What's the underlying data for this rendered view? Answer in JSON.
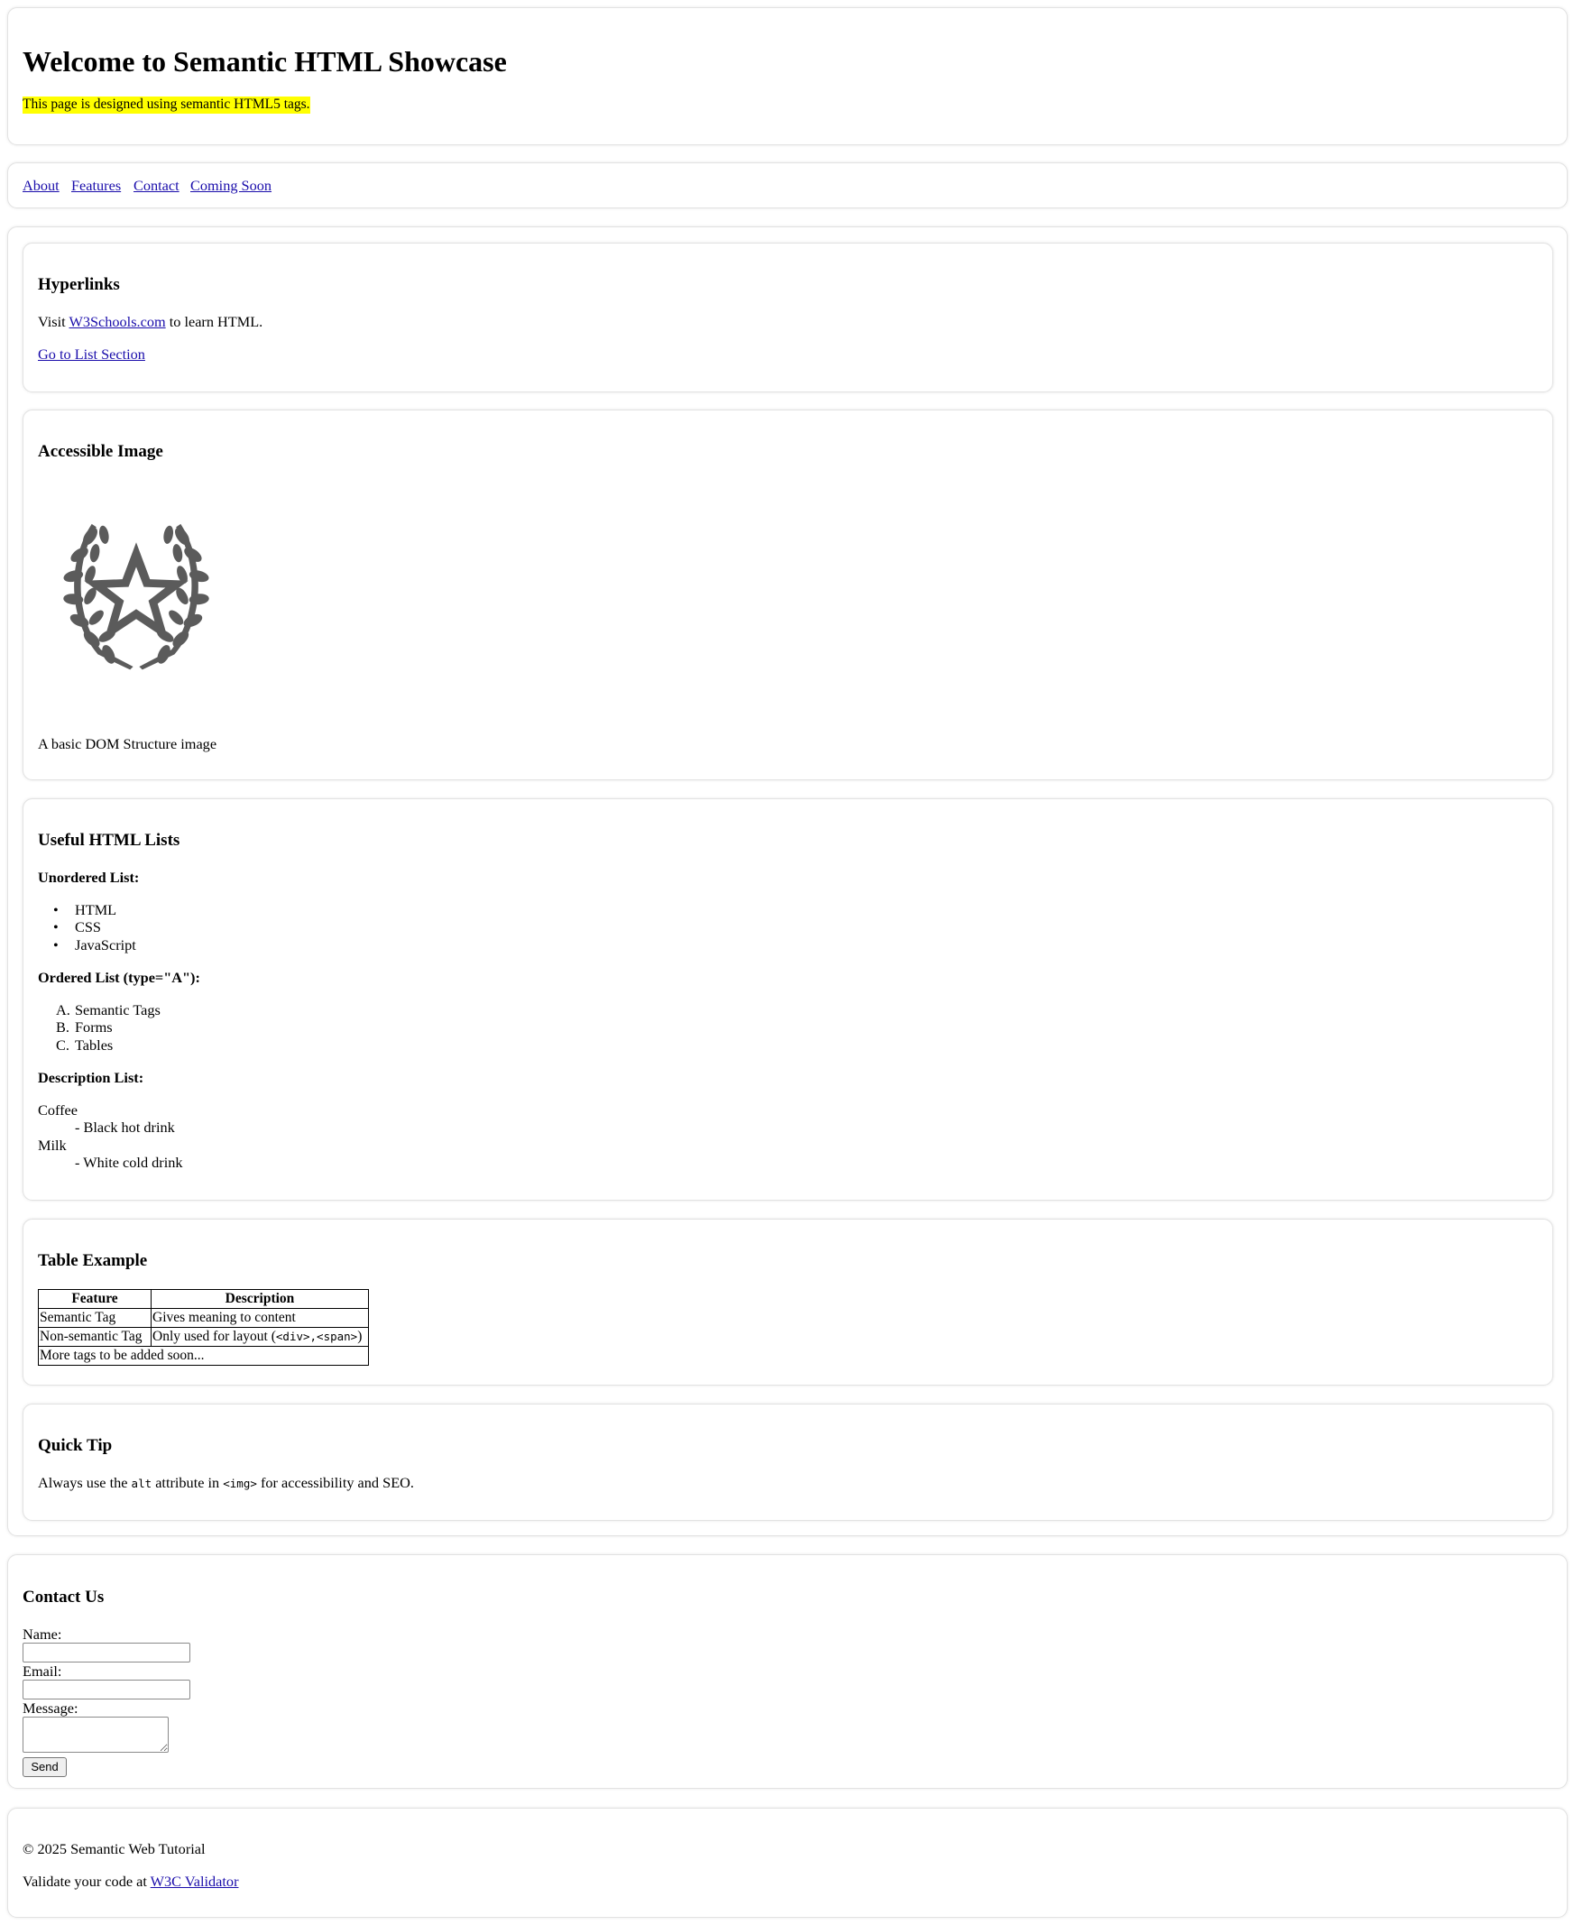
{
  "header": {
    "title": "Welcome to Semantic HTML Showcase",
    "highlight": "This page is designed using semantic HTML5 tags."
  },
  "nav": {
    "links": [
      "About",
      "Features",
      "Contact",
      "Coming Soon"
    ]
  },
  "hyperlinks": {
    "heading": "Hyperlinks",
    "visit_prefix": "Visit ",
    "visit_link": "W3Schools.com",
    "visit_suffix": " to learn HTML.",
    "anchor_link": "Go to List Section"
  },
  "image_section": {
    "heading": "Accessible Image",
    "caption": "A basic DOM Structure image",
    "image_icon": "laurel-star-emblem-icon",
    "image_color": "#5b5b5b"
  },
  "lists": {
    "heading": "Useful HTML Lists",
    "unordered_label": "Unordered List:",
    "unordered_items": [
      "HTML",
      "CSS",
      "JavaScript"
    ],
    "ordered_label": "Ordered List (type=\"A\"):",
    "ordered_markers": [
      "A.",
      "B.",
      "C."
    ],
    "ordered_items": [
      "Semantic Tags",
      "Forms",
      "Tables"
    ],
    "description_label": "Description List:",
    "terms": [
      "Coffee",
      "Milk"
    ],
    "definitions": [
      "- Black hot drink",
      "- White cold drink"
    ]
  },
  "table_section": {
    "heading": "Table Example",
    "headers": [
      "Feature",
      "Description"
    ],
    "rows": [
      [
        "Semantic Tag",
        "Gives meaning to content"
      ],
      [
        "Non-semantic Tag",
        "Only used for layout ("
      ]
    ],
    "code_sample": "<div>,<span>",
    "code_suffix": ")",
    "footer_row": "More tags to be added soon..."
  },
  "tip": {
    "heading": "Quick Tip",
    "part1": "Always use the ",
    "code1": "alt",
    "part2": " attribute in ",
    "code2": "<img>",
    "part3": " for accessibility and SEO."
  },
  "contact": {
    "heading": "Contact Us",
    "name_label": "Name:",
    "email_label": "Email:",
    "message_label": "Message:",
    "name_value": "",
    "email_value": "",
    "message_value": "",
    "send_label": "Send"
  },
  "footer": {
    "copyright": "© 2025 Semantic Web Tutorial",
    "validate_prefix": "Validate your code at ",
    "validate_link": "W3C Validator"
  }
}
